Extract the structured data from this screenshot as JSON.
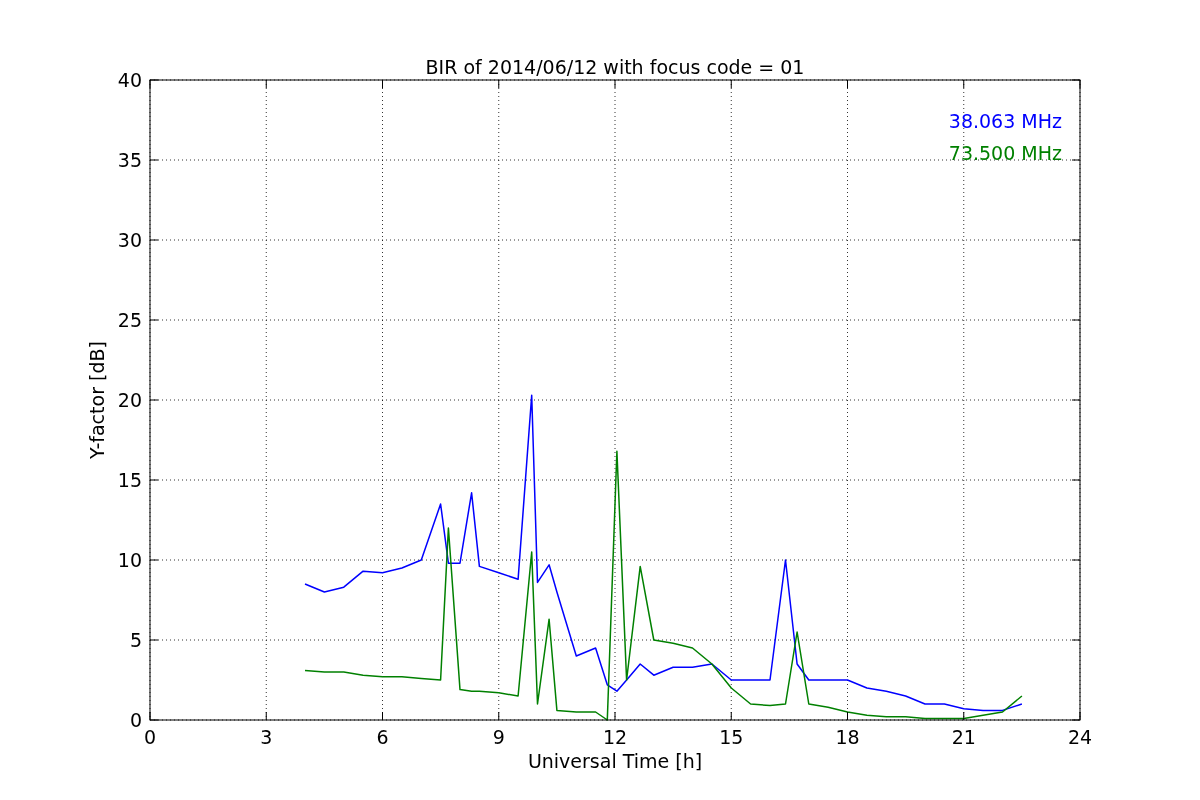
{
  "chart_data": {
    "type": "line",
    "title": "BIR of 2014/06/12 with focus code = 01",
    "xlabel": "Universal Time [h]",
    "ylabel": "Y-factor [dB]",
    "x": [
      4,
      4.5,
      5,
      5.5,
      6,
      6.5,
      7,
      7.5,
      7.7,
      8,
      8.3,
      8.5,
      9,
      9.5,
      9.85,
      10,
      10.3,
      10.5,
      11,
      11.5,
      11.8,
      12.05,
      12.3,
      12.65,
      13,
      13.5,
      14,
      14.5,
      15,
      15.5,
      16,
      16.4,
      16.7,
      17,
      17.5,
      18,
      18.5,
      19,
      19.5,
      20,
      20.5,
      21,
      21.5,
      22,
      22.5
    ],
    "series": [
      {
        "name": "38.063 MHz",
        "color": "#0000ff",
        "values": [
          8.5,
          8.0,
          8.3,
          9.3,
          9.2,
          9.5,
          10.0,
          13.5,
          9.8,
          9.8,
          14.2,
          9.6,
          9.2,
          8.8,
          20.3,
          8.6,
          9.7,
          8.0,
          4.0,
          4.5,
          2.2,
          1.8,
          2.5,
          3.5,
          2.8,
          3.3,
          3.3,
          3.5,
          2.5,
          2.5,
          2.5,
          10.0,
          3.5,
          2.5,
          2.5,
          2.5,
          2.0,
          1.8,
          1.5,
          1.0,
          1.0,
          0.7,
          0.6,
          0.6,
          1.0
        ]
      },
      {
        "name": "73.500 MHz",
        "color": "#008000",
        "values": [
          3.1,
          3.0,
          3.0,
          2.8,
          2.7,
          2.7,
          2.6,
          2.5,
          12.0,
          1.9,
          1.8,
          1.8,
          1.7,
          1.5,
          10.5,
          1.0,
          6.3,
          0.6,
          0.5,
          0.5,
          0.0,
          16.8,
          2.5,
          9.6,
          5.0,
          4.8,
          4.5,
          3.5,
          2.0,
          1.0,
          0.9,
          1.0,
          5.5,
          1.0,
          0.8,
          0.5,
          0.3,
          0.2,
          0.2,
          0.1,
          0.1,
          0.1,
          0.3,
          0.5,
          1.5
        ]
      }
    ],
    "grid": true,
    "xlim": [
      0,
      24
    ],
    "ylim": [
      0,
      40
    ],
    "xticks": [
      0,
      3,
      6,
      9,
      12,
      15,
      18,
      21,
      24
    ],
    "yticks": [
      0,
      5,
      10,
      15,
      20,
      25,
      30,
      35,
      40
    ]
  }
}
